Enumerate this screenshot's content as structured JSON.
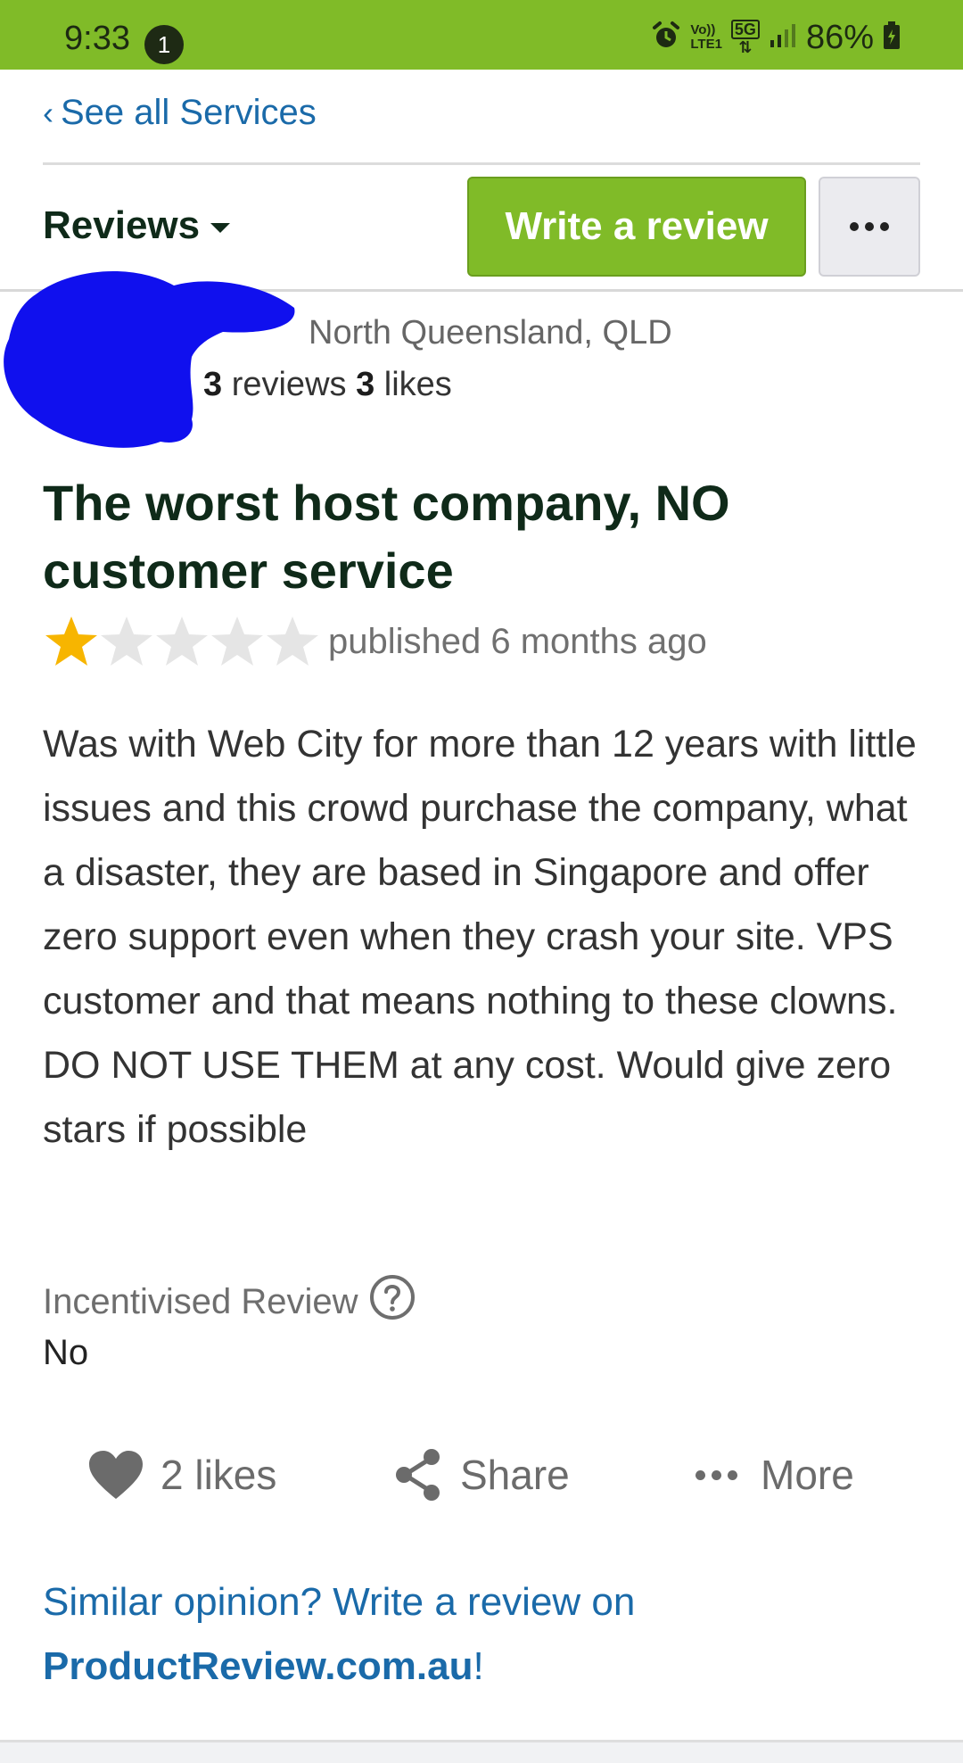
{
  "status_bar": {
    "time": "9:33",
    "notification_count": "1",
    "network_label_top": "Vo))",
    "network_label_bottom": "LTE1",
    "network_type": "5G",
    "battery": "86%"
  },
  "nav": {
    "back_label": "See all Services"
  },
  "toolbar": {
    "reviews_label": "Reviews",
    "write_review_label": "Write a review"
  },
  "reviewer": {
    "location": "North Queensland, QLD",
    "reviews_count": "3",
    "reviews_word": "reviews",
    "likes_count": "3",
    "likes_word": "likes"
  },
  "review": {
    "title": "The worst host company, NO customer service",
    "rating": 1,
    "rating_max": 5,
    "published": "published 6 months ago",
    "body": "Was with Web City for more than 12 years with little issues and this crowd purchase the company, what a disaster, they are based in Singapore and offer zero support even when they crash your site. VPS customer and that means nothing to these clowns. DO NOT USE THEM at any cost. Would give zero stars if possible",
    "incentive_label": "Incentivised Review",
    "incentive_value": "No"
  },
  "actions": {
    "likes_label": "2 likes",
    "share_label": "Share",
    "more_label": "More"
  },
  "footer": {
    "cta_text": "Similar opinion? Write a review on ",
    "site_name": "ProductReview.com.au",
    "cta_end": "!"
  },
  "colors": {
    "brand_green": "#80bb28",
    "link_blue": "#1a6aa9",
    "title_dark": "#0f2a19",
    "star_gold": "#f7b500",
    "star_empty": "#e5e5e5",
    "redaction_blue": "#1010ee"
  },
  "icons": {
    "alarm": "alarm-icon",
    "signal": "signal-icon",
    "battery": "battery-icon",
    "caret": "caret-down-icon",
    "more": "more-dots-icon",
    "heart": "heart-icon",
    "share": "share-icon",
    "help": "help-icon"
  }
}
